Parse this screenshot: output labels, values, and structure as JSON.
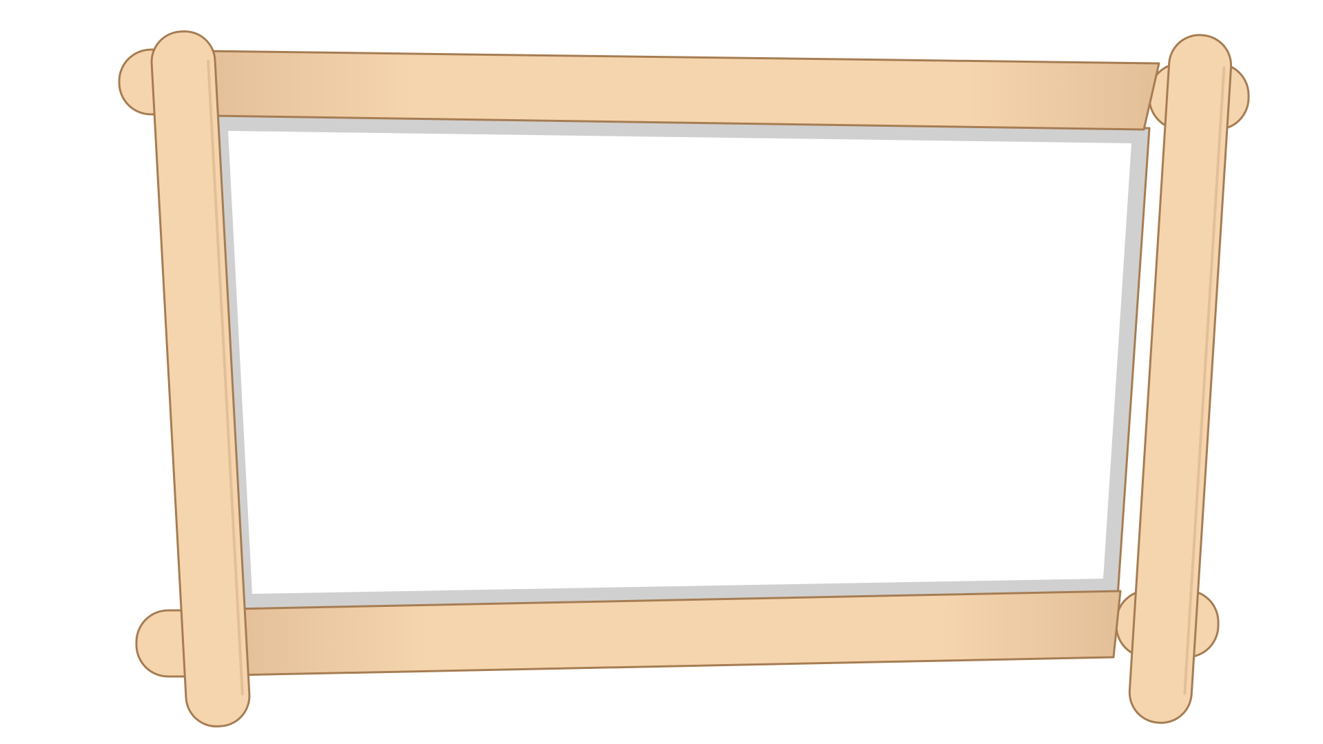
{
  "colors": {
    "background": "#ffffff",
    "stick_fill": "#f5d5ae",
    "stick_shade": "#e3bf98",
    "stick_outline": "#a67c52",
    "mat_fill": "#d0d0d0",
    "picture_fill": "#ffffff"
  },
  "icons": {
    "frame": "popsicle-stick-frame-icon"
  }
}
